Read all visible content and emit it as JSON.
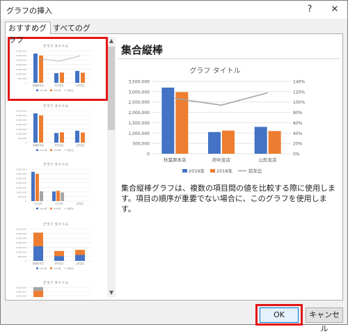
{
  "window": {
    "title": "グラフの挿入",
    "help_icon": "?",
    "close_icon": "✕"
  },
  "tabs": [
    {
      "label": "おすすめグラフ",
      "active": true
    },
    {
      "label": "すべてのグラフ",
      "active": false
    }
  ],
  "thumbnails": [
    {
      "title": "グラフ タイトル",
      "kind": "clustered-column-with-line",
      "selected": true
    },
    {
      "title": "グラフ タイトル",
      "kind": "clustered-column"
    },
    {
      "title": "グラフ タイトル",
      "kind": "clustered-column-by-year"
    },
    {
      "title": "グラフ タイトル",
      "kind": "stacked-column"
    },
    {
      "title": "グラフ タイトル",
      "kind": "stacked-column-2"
    }
  ],
  "thumbnail_axis_labels": [
    "3,500,000",
    "3,000,000",
    "2,500,000",
    "2,000,000",
    "1,500,000",
    "1,000,000",
    "500,000",
    "0"
  ],
  "thumbnail_year_categories": [
    "2019年",
    "2018年",
    "前年比"
  ],
  "main": {
    "chart_type_title": "集合縦棒",
    "description": "集合縦棒グラフは、複数の項目間の値を比較する際に使用します。項目の順序が重要でない場合に、このグラフを使用します。"
  },
  "chart_data": {
    "type": "bar",
    "title": "グラフ タイトル",
    "categories": [
      "秋葉原本店",
      "府中支店",
      "山形支店"
    ],
    "series": [
      {
        "name": "2019年",
        "type": "bar",
        "axis": "left",
        "color": "#4472c4",
        "values": [
          3200000,
          1050000,
          1300000
        ]
      },
      {
        "name": "2018年",
        "type": "bar",
        "axis": "left",
        "color": "#ed7d31",
        "values": [
          2980000,
          1120000,
          1100000
        ]
      },
      {
        "name": "前年比",
        "type": "line",
        "axis": "right",
        "color": "#a5a5a5",
        "values": [
          1.07,
          0.94,
          1.18
        ]
      }
    ],
    "ylim": [
      0,
      3500000
    ],
    "y_ticks": [
      "3,500,000",
      "3,000,000",
      "2,500,000",
      "2,000,000",
      "1,500,000",
      "1,000,000",
      "500,000",
      "0"
    ],
    "y2lim": [
      0,
      1.4
    ],
    "y2_ticks": [
      "140%",
      "120%",
      "100%",
      "80%",
      "60%",
      "40%",
      "20%",
      "0%"
    ],
    "grid": true,
    "legend": "bottom"
  },
  "buttons": {
    "ok": "OK",
    "cancel": "キャンセル"
  },
  "colors": {
    "blue": "#4472c4",
    "orange": "#ed7d31",
    "gray": "#a5a5a5",
    "highlight": "#e41515"
  }
}
